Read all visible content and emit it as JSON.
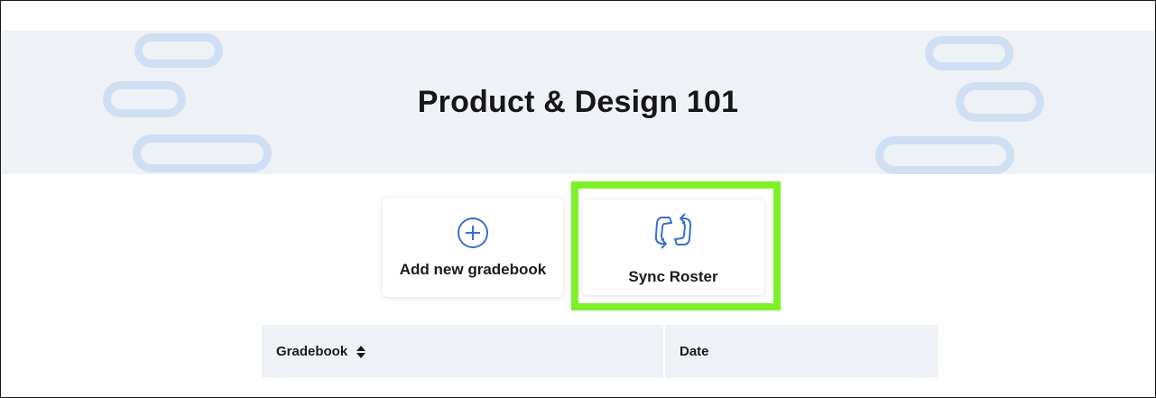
{
  "course": {
    "title": "Product & Design 101"
  },
  "actions": {
    "add_gradebook": {
      "label": "Add new gradebook",
      "icon": "plus-circle-icon"
    },
    "sync_roster": {
      "label": "Sync Roster",
      "icon": "sync-arrows-icon"
    }
  },
  "table": {
    "columns": [
      {
        "label": "Gradebook",
        "sortable": true,
        "icon": "sort-icon"
      },
      {
        "label": "Date",
        "sortable": false
      }
    ]
  },
  "colors": {
    "accent_blue": "#3b6fd0",
    "highlight_green": "#7cf12a",
    "banner_bg": "#eef1f5",
    "pill": "#cfe0f4"
  }
}
